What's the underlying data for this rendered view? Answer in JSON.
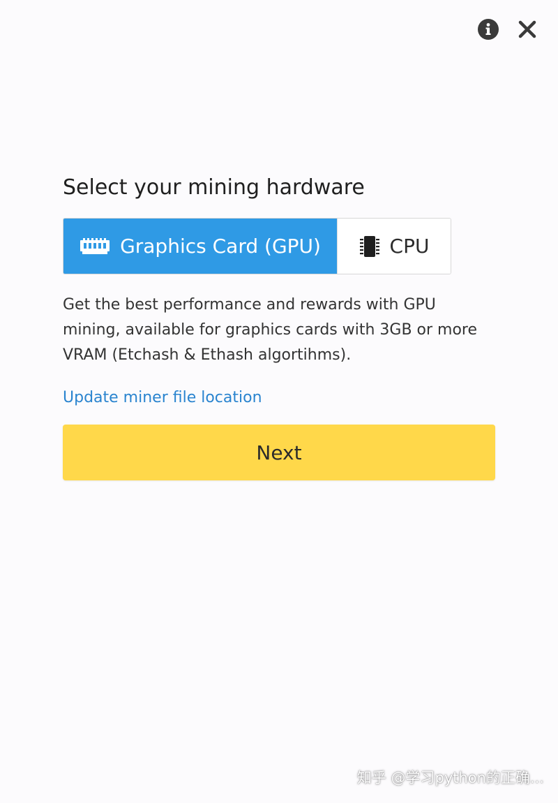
{
  "window": {
    "info_icon": "info-icon",
    "close_icon": "close-icon"
  },
  "main": {
    "heading": "Select your mining hardware",
    "options": [
      {
        "label": "Graphics Card (GPU)",
        "icon": "gpu-icon",
        "selected": true
      },
      {
        "label": "CPU",
        "icon": "cpu-icon",
        "selected": false
      }
    ],
    "description": "Get the best performance and rewards with GPU mining, available for graphics cards with 3GB or more VRAM (Etchash & Ethash algortihms).",
    "update_link": "Update miner file location",
    "next_label": "Next"
  },
  "watermark": "知乎 @学习python的正确...",
  "colors": {
    "background": "#fcfbfd",
    "selected_option": "#2f9ae5",
    "link": "#2a84cf",
    "next_button": "#ffd84a"
  }
}
